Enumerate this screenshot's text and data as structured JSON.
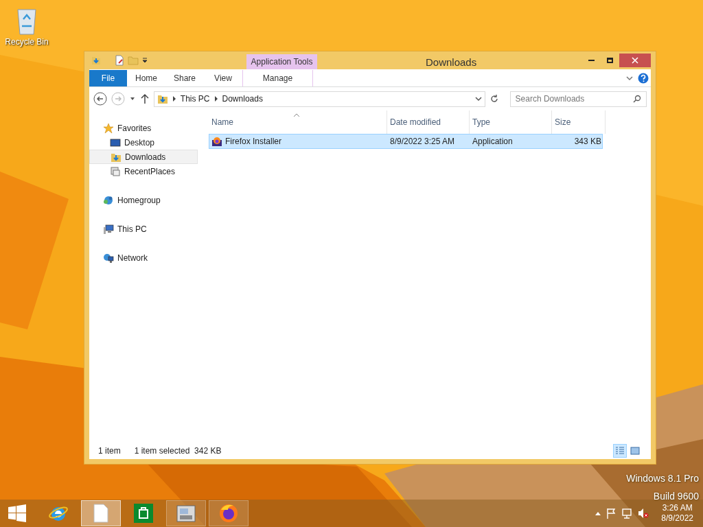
{
  "desktop_icons": [
    {
      "label": "Recycle Bin"
    }
  ],
  "window": {
    "title": "Downloads",
    "contextual_group": "Application Tools",
    "ribbon_tabs": [
      {
        "label": "File",
        "kind": "file",
        "selected": false
      },
      {
        "label": "Home",
        "kind": "plain",
        "selected": false
      },
      {
        "label": "Share",
        "kind": "plain",
        "selected": false
      },
      {
        "label": "View",
        "kind": "plain",
        "selected": false
      },
      {
        "label": "Manage",
        "kind": "contextual",
        "selected": false
      }
    ],
    "address": [
      "This PC",
      "Downloads"
    ],
    "search": {
      "placeholder": "Search Downloads"
    },
    "nav": [
      {
        "label": "Favorites",
        "kind": "star",
        "selected": false,
        "children": [
          {
            "label": "Desktop",
            "kind": "desktop",
            "selected": false
          },
          {
            "label": "Downloads",
            "kind": "downloads",
            "selected": true
          },
          {
            "label": "RecentPlaces",
            "kind": "recent",
            "selected": false
          }
        ]
      },
      {
        "label": "Homegroup",
        "kind": "homegroup",
        "selected": false
      },
      {
        "label": "This PC",
        "kind": "pc",
        "selected": false
      },
      {
        "label": "Network",
        "kind": "network",
        "selected": false
      }
    ],
    "columns": [
      "Name",
      "Date modified",
      "Type",
      "Size"
    ],
    "rows": [
      {
        "name": "Firefox Installer",
        "date": "8/9/2022 3:25 AM",
        "type": "Application",
        "size": "343 KB",
        "selected": true
      }
    ],
    "status": {
      "count": "1 item",
      "selection": "1 item selected  342 KB"
    },
    "views": [
      {
        "kind": "details",
        "selected": true
      },
      {
        "kind": "thumbnails",
        "selected": false
      }
    ]
  },
  "taskbar": {
    "apps": [
      {
        "kind": "ie",
        "selected": false
      },
      {
        "kind": "explorer",
        "selected": true
      },
      {
        "kind": "store",
        "selected": false
      },
      {
        "kind": "viewer",
        "selected": false
      },
      {
        "kind": "firefox",
        "selected": false
      }
    ],
    "time": "3:26 AM",
    "date": "8/9/2022"
  },
  "watermark": [
    "Windows 8.1 Pro",
    "Build 9600"
  ]
}
